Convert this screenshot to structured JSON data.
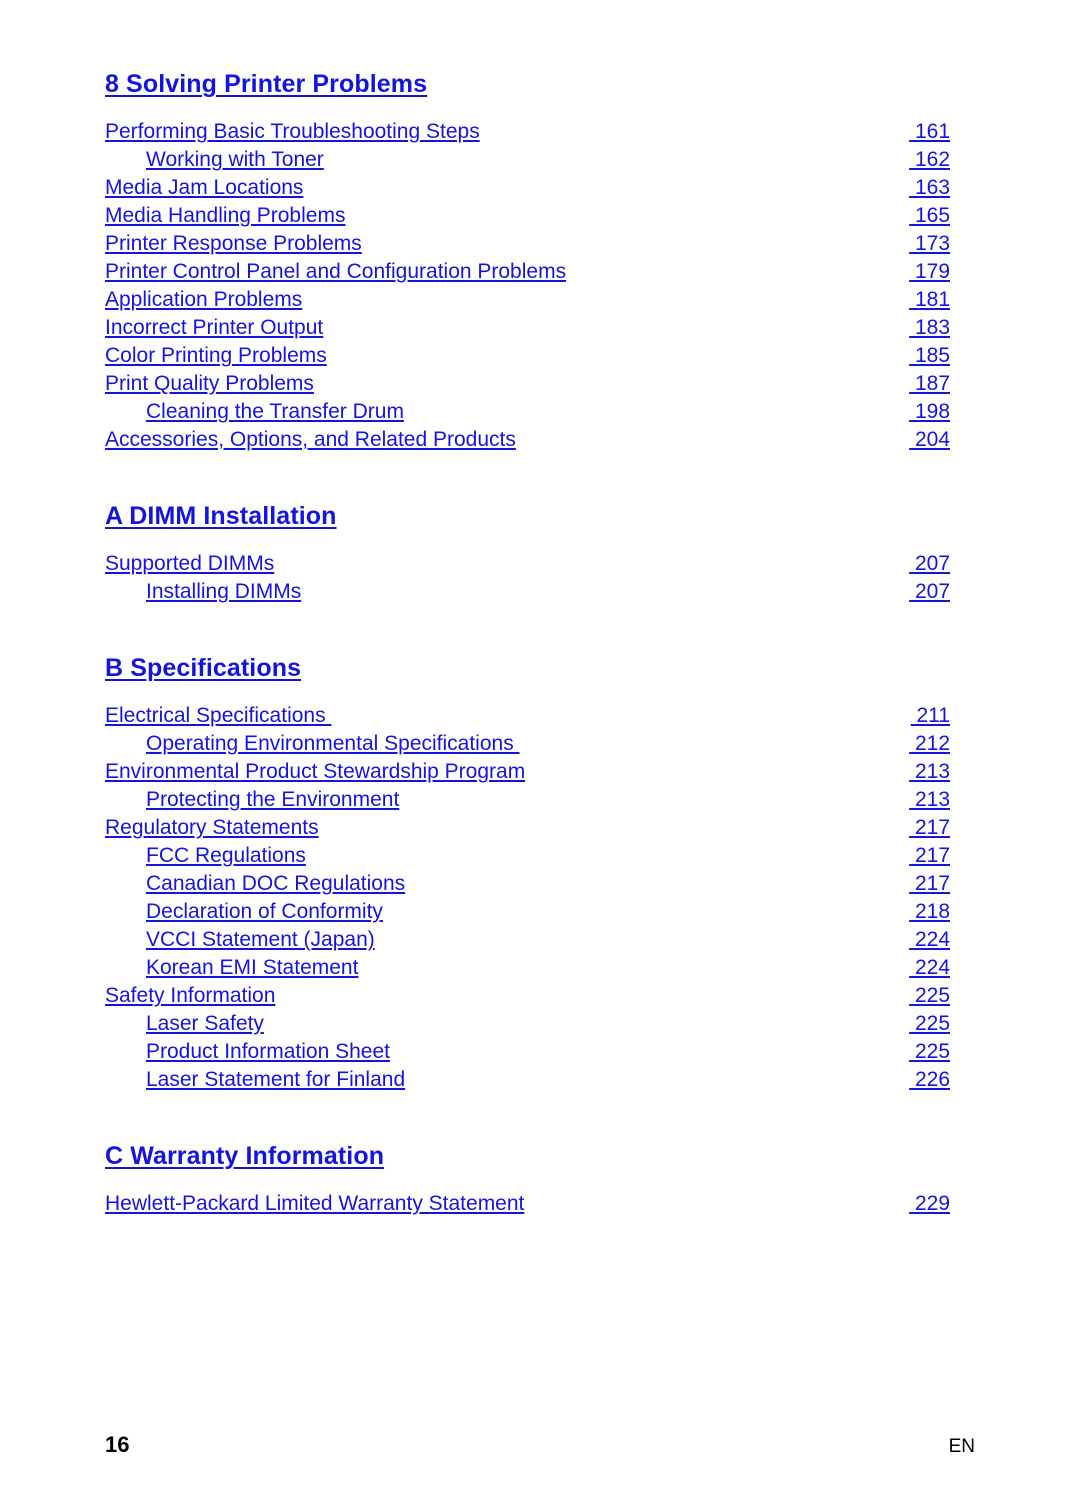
{
  "document": {
    "type": "table-of-contents",
    "link_color": "#1414e0",
    "text_color": "#000000",
    "background_color": "#ffffff"
  },
  "sections": [
    {
      "heading": "8 Solving Printer Problems",
      "entries": [
        {
          "title": "Performing Basic Troubleshooting Steps",
          "page": " 161",
          "level": 1
        },
        {
          "title": "Working with Toner",
          "page": " 162",
          "level": 2
        },
        {
          "title": "Media Jam Locations",
          "page": " 163",
          "level": 1
        },
        {
          "title": "Media Handling Problems",
          "page": " 165",
          "level": 1
        },
        {
          "title": "Printer Response Problems",
          "page": " 173",
          "level": 1
        },
        {
          "title": "Printer Control Panel and Configuration Problems",
          "page": " 179",
          "level": 1
        },
        {
          "title": "Application Problems",
          "page": " 181",
          "level": 1
        },
        {
          "title": "Incorrect Printer Output",
          "page": " 183",
          "level": 1
        },
        {
          "title": "Color Printing Problems",
          "page": " 185",
          "level": 1
        },
        {
          "title": "Print Quality Problems",
          "page": " 187",
          "level": 1
        },
        {
          "title": "Cleaning the Transfer Drum",
          "page": " 198",
          "level": 2
        },
        {
          "title": "Accessories, Options, and Related Products",
          "page": " 204",
          "level": 1
        }
      ]
    },
    {
      "heading": "A DIMM Installation",
      "entries": [
        {
          "title": "Supported DIMMs",
          "page": " 207",
          "level": 1
        },
        {
          "title": "Installing DIMMs",
          "page": " 207",
          "level": 2
        }
      ]
    },
    {
      "heading": "B Specifications",
      "entries": [
        {
          "title": "Electrical Specifications ",
          "page": " 211",
          "level": 1
        },
        {
          "title": "Operating Environmental Specifications ",
          "page": " 212",
          "level": 2
        },
        {
          "title": "Environmental Product Stewardship Program",
          "page": " 213",
          "level": 1
        },
        {
          "title": "Protecting the Environment",
          "page": " 213",
          "level": 2
        },
        {
          "title": "Regulatory Statements",
          "page": " 217",
          "level": 1
        },
        {
          "title": "FCC Regulations",
          "page": " 217",
          "level": 2
        },
        {
          "title": "Canadian DOC Regulations",
          "page": " 217",
          "level": 2
        },
        {
          "title": "Declaration of Conformity",
          "page": " 218",
          "level": 2
        },
        {
          "title": "VCCI Statement (Japan)",
          "page": " 224",
          "level": 2
        },
        {
          "title": "Korean EMI Statement",
          "page": " 224",
          "level": 2
        },
        {
          "title": "Safety Information",
          "page": " 225",
          "level": 1
        },
        {
          "title": "Laser Safety",
          "page": " 225",
          "level": 2
        },
        {
          "title": "Product Information Sheet",
          "page": " 225",
          "level": 2
        },
        {
          "title": "Laser Statement for Finland",
          "page": " 226",
          "level": 2
        }
      ]
    },
    {
      "heading": "C Warranty Information",
      "entries": [
        {
          "title": "Hewlett-Packard Limited Warranty Statement",
          "page": " 229",
          "level": 1
        }
      ]
    }
  ],
  "footer": {
    "page_number": "16",
    "language": "EN"
  }
}
